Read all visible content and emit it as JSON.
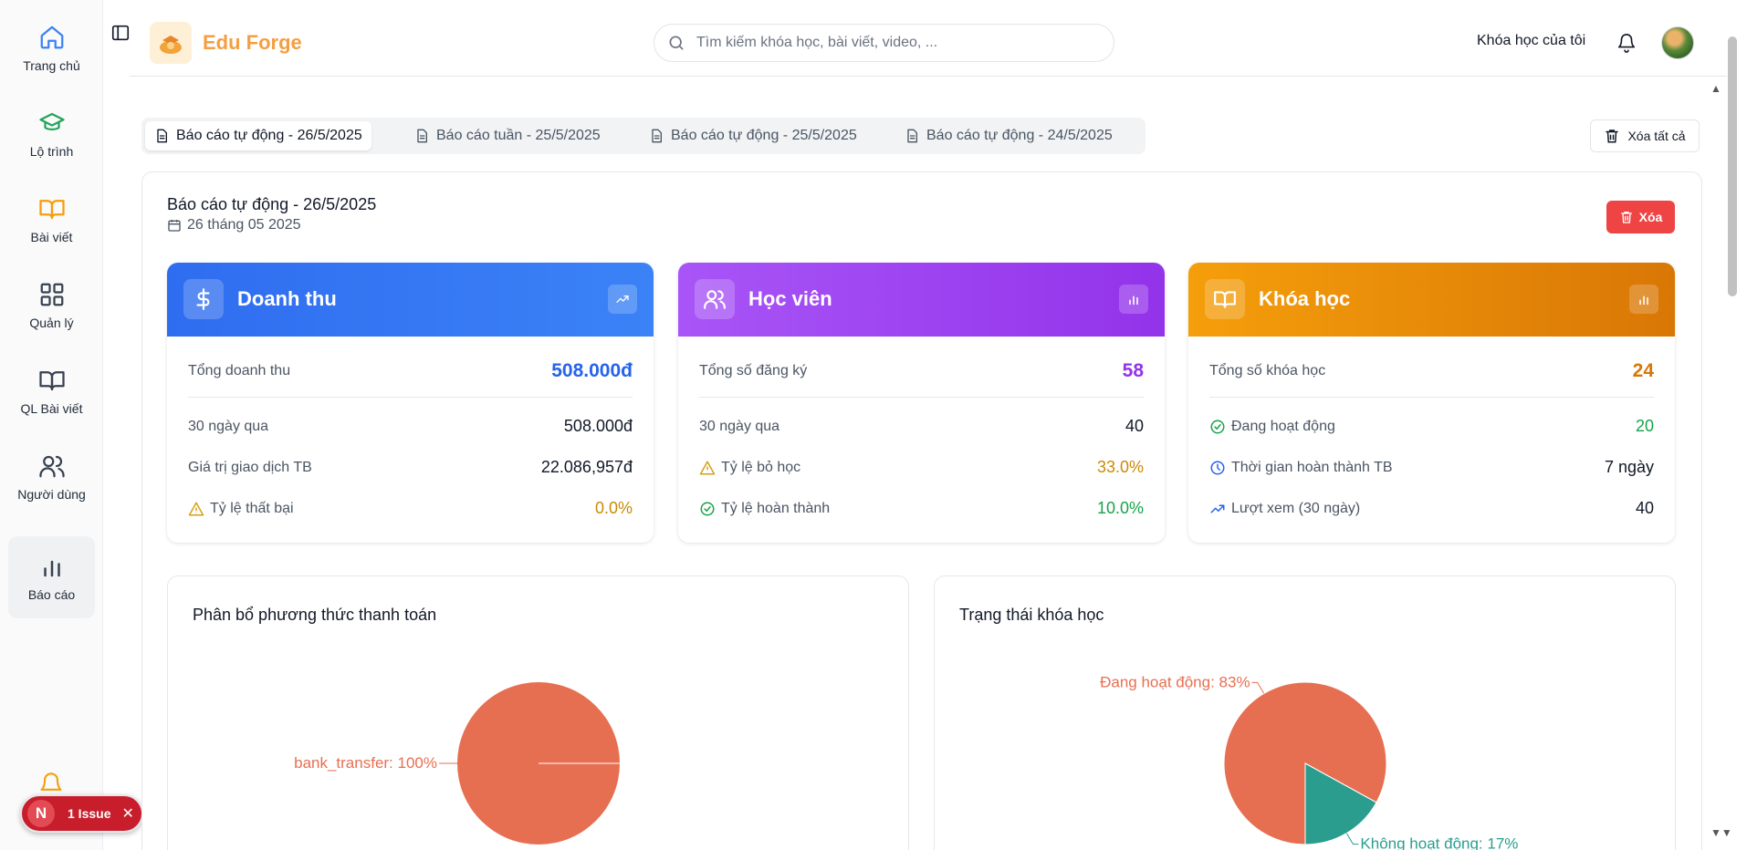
{
  "sidebar": {
    "items": [
      {
        "label": "Trang chủ",
        "icon": "home-icon"
      },
      {
        "label": "Lộ trình",
        "icon": "graduation-cap-icon"
      },
      {
        "label": "Bài viết",
        "icon": "book-open-icon"
      },
      {
        "label": "Quản lý",
        "icon": "grid-icon"
      },
      {
        "label": "QL Bài viết",
        "icon": "book-icon"
      },
      {
        "label": "Người dùng",
        "icon": "users-icon"
      },
      {
        "label": "Báo cáo",
        "icon": "bar-chart-icon"
      }
    ],
    "active": "Báo cáo"
  },
  "issue": {
    "initial": "N",
    "label": "1 Issue"
  },
  "header": {
    "brand": "Edu Forge",
    "search_placeholder": "Tìm kiếm khóa học, bài viết, video, ...",
    "my_courses": "Khóa học của tôi"
  },
  "tabs": [
    {
      "label": "Báo cáo tự động - 26/5/2025",
      "active": true
    },
    {
      "label": "Báo cáo tuần - 25/5/2025",
      "active": false
    },
    {
      "label": "Báo cáo tự động - 25/5/2025",
      "active": false
    },
    {
      "label": "Báo cáo tự động - 24/5/2025",
      "active": false
    }
  ],
  "clear_all_label": "Xóa tất cả",
  "report": {
    "title": "Báo cáo tự động - 26/5/2025",
    "date": "26 tháng 05 2025",
    "delete_label": "Xóa"
  },
  "cards": {
    "revenue": {
      "title": "Doanh thu",
      "color": "#2f6df0",
      "total_label": "Tổng doanh thu",
      "total_value": "508.000đ",
      "r1_label": "30 ngày qua",
      "r1_value": "508.000đ",
      "r2_label": "Giá trị giao dịch TB",
      "r2_value": "22.086,957đ",
      "r3_label": "Tỷ lệ thất bại",
      "r3_value": "0.0%"
    },
    "students": {
      "title": "Học viên",
      "color": "#9333ea",
      "total_label": "Tổng số đăng ký",
      "total_value": "58",
      "r1_label": "30 ngày qua",
      "r1_value": "40",
      "r2_label": "Tỷ lệ bỏ học",
      "r2_value": "33.0%",
      "r3_label": "Tỷ lệ hoàn thành",
      "r3_value": "10.0%"
    },
    "courses": {
      "title": "Khóa học",
      "color": "#f59e0b",
      "total_label": "Tổng số khóa học",
      "total_value": "24",
      "r1_label": "Đang hoạt động",
      "r1_value": "20",
      "r2_label": "Thời gian hoàn thành TB",
      "r2_value": "7 ngày",
      "r3_label": "Lượt xem (30 ngày)",
      "r3_value": "40"
    }
  },
  "chart_data": [
    {
      "type": "pie",
      "title": "Phân bổ phương thức thanh toán",
      "slices": [
        {
          "label": "bank_transfer",
          "value": 100,
          "color": "#e76f51",
          "display": "bank_transfer: 100%"
        }
      ]
    },
    {
      "type": "pie",
      "title": "Trạng thái khóa học",
      "slices": [
        {
          "label": "Đang hoạt động",
          "value": 83,
          "color": "#e76f51",
          "display": "Đang hoạt động: 83%"
        },
        {
          "label": "Không hoạt động",
          "value": 17,
          "color": "#2a9d8f",
          "display": "Không hoạt động: 17%"
        }
      ]
    }
  ]
}
